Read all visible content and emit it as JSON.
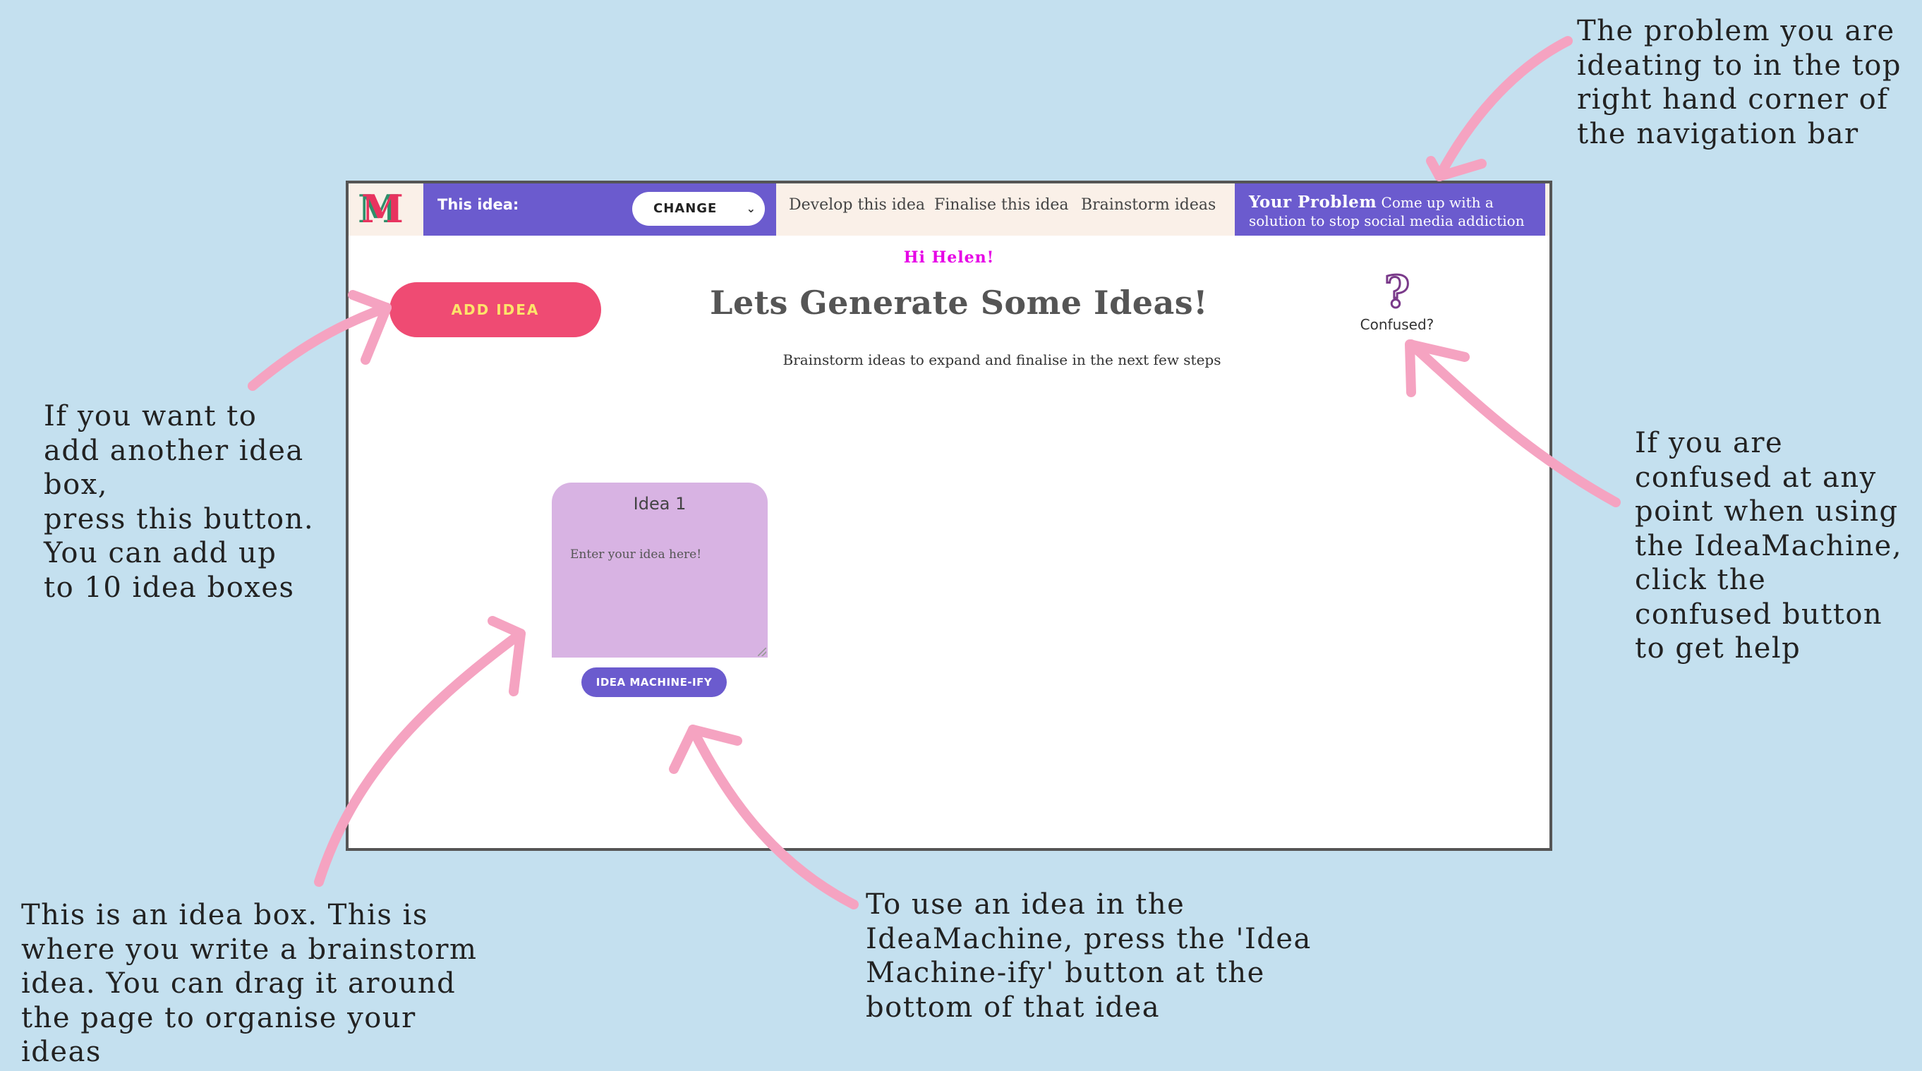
{
  "annotations": {
    "top_right": "The problem you are\nideating to in the top\nright hand corner of\nthe navigation bar",
    "left": "If you want to\nadd another idea\nbox,\npress this button.\nYou can add up\nto 10 idea boxes",
    "right": "If you are\nconfused at any\npoint when using\nthe IdeaMachine,\nclick the\nconfused button\nto get help",
    "bottom_left": "This is an idea box. This is\nwhere you write a brainstorm\nidea. You can drag it around\nthe page to organise your\nideas",
    "bottom_mid": "To use an idea in the\nIdeaMachine, press the 'Idea\nMachine-ify' button at the\nbottom of that idea"
  },
  "app": {
    "logo": "M",
    "navbar": {
      "this_idea_label": "This idea:",
      "change_select_value": "CHANGE",
      "links": [
        "Develop this idea",
        "Finalise this idea",
        "Brainstorm ideas"
      ],
      "problem_label": "Your Problem",
      "problem_text": "Come up with a solution to stop social media addiction"
    },
    "greeting": "Hi Helen!",
    "add_idea_button": "ADD IDEA",
    "heading": "Lets Generate Some Ideas!",
    "subheading": "Brainstorm ideas to expand and finalise in the next few steps",
    "confused": {
      "icon": "?",
      "label": "Confused?"
    },
    "idea_box": {
      "title": "Idea 1",
      "placeholder": "Enter your idea here!",
      "button": "IDEA MACHINE-IFY"
    }
  },
  "colors": {
    "background": "#c4e0ef",
    "nav_purple": "#6b5bce",
    "add_idea": "#ef4b73",
    "idea_box": "#d8b3e3",
    "greeting": "#e600e6",
    "arrow_pink": "#f5a3c1"
  }
}
